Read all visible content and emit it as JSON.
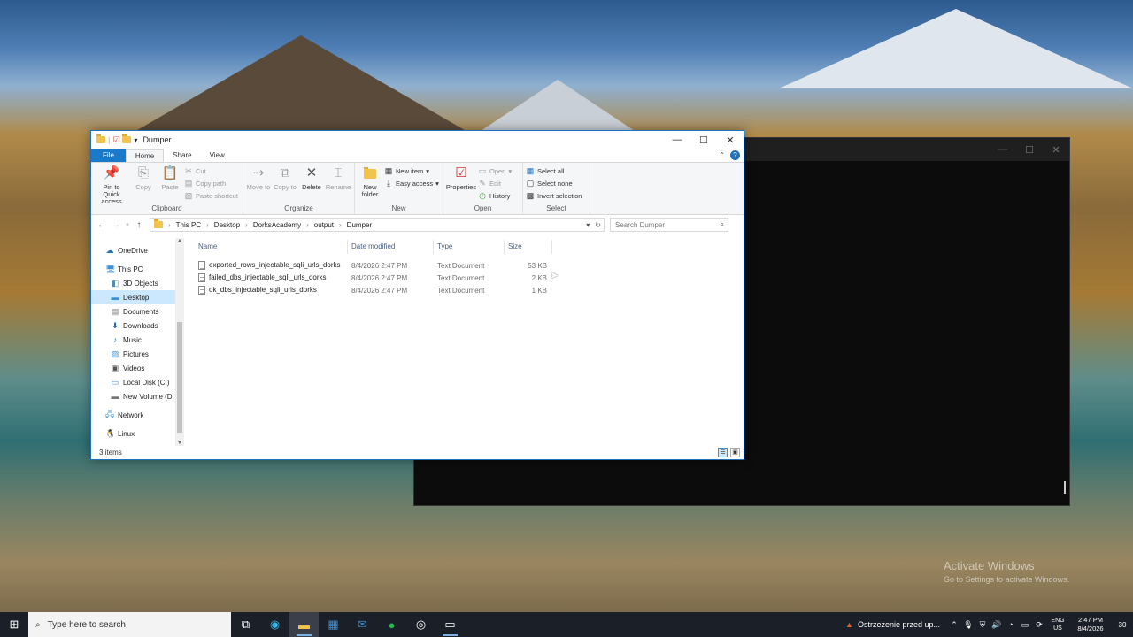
{
  "watermark": {
    "title": "Activate Windows",
    "subtitle": "Go to Settings to activate Windows."
  },
  "explorer": {
    "title": "Dumper",
    "window_controls": {
      "minimize": "—",
      "maximize": "☐",
      "close": "✕"
    },
    "ribbon_tabs": [
      "File",
      "Home",
      "Share",
      "View"
    ],
    "ribbon": {
      "clipboard": {
        "label": "Clipboard",
        "pin": "Pin to Quick access",
        "copy": "Copy",
        "paste": "Paste",
        "cut": "Cut",
        "copy_path": "Copy path",
        "paste_shortcut": "Paste shortcut"
      },
      "organize": {
        "label": "Organize",
        "move_to": "Move to",
        "copy_to": "Copy to",
        "delete": "Delete",
        "rename": "Rename"
      },
      "new": {
        "label": "New",
        "new_folder": "New folder",
        "new_item": "New item",
        "easy_access": "Easy access"
      },
      "open": {
        "label": "Open",
        "properties": "Properties",
        "open": "Open",
        "edit": "Edit",
        "history": "History"
      },
      "select": {
        "label": "Select",
        "select_all": "Select all",
        "select_none": "Select none",
        "invert": "Invert selection"
      }
    },
    "breadcrumb": [
      "This PC",
      "Desktop",
      "DorksAcademy",
      "output",
      "Dumper"
    ],
    "search_placeholder": "Search Dumper",
    "nav_pane": {
      "onedrive": "OneDrive",
      "this_pc": "This PC",
      "items": [
        "3D Objects",
        "Desktop",
        "Documents",
        "Downloads",
        "Music",
        "Pictures",
        "Videos",
        "Local Disk (C:)",
        "New Volume (D:"
      ],
      "network": "Network",
      "linux": "Linux"
    },
    "columns": {
      "name": "Name",
      "date": "Date modified",
      "type": "Type",
      "size": "Size"
    },
    "files": [
      {
        "name": "exported_rows_injectable_sqli_urls_dorks",
        "date": "8/4/2026 2:47 PM",
        "type": "Text Document",
        "size": "53 KB"
      },
      {
        "name": "failed_dbs_injectable_sqli_urls_dorks",
        "date": "8/4/2026 2:47 PM",
        "type": "Text Document",
        "size": "2 KB"
      },
      {
        "name": "ok_dbs_injectable_sqli_urls_dorks",
        "date": "8/4/2026 2:47 PM",
        "type": "Text Document",
        "size": "1 KB"
      }
    ],
    "status": "3 items"
  },
  "taskbar": {
    "search_placeholder": "Type here to search",
    "notification_app": "Ostrzeżenie przed up...",
    "lang": {
      "line1": "ENG",
      "line2": "US"
    },
    "clock": {
      "time": "2:47 PM",
      "date": "8/4/2026"
    },
    "action_count": "30"
  }
}
